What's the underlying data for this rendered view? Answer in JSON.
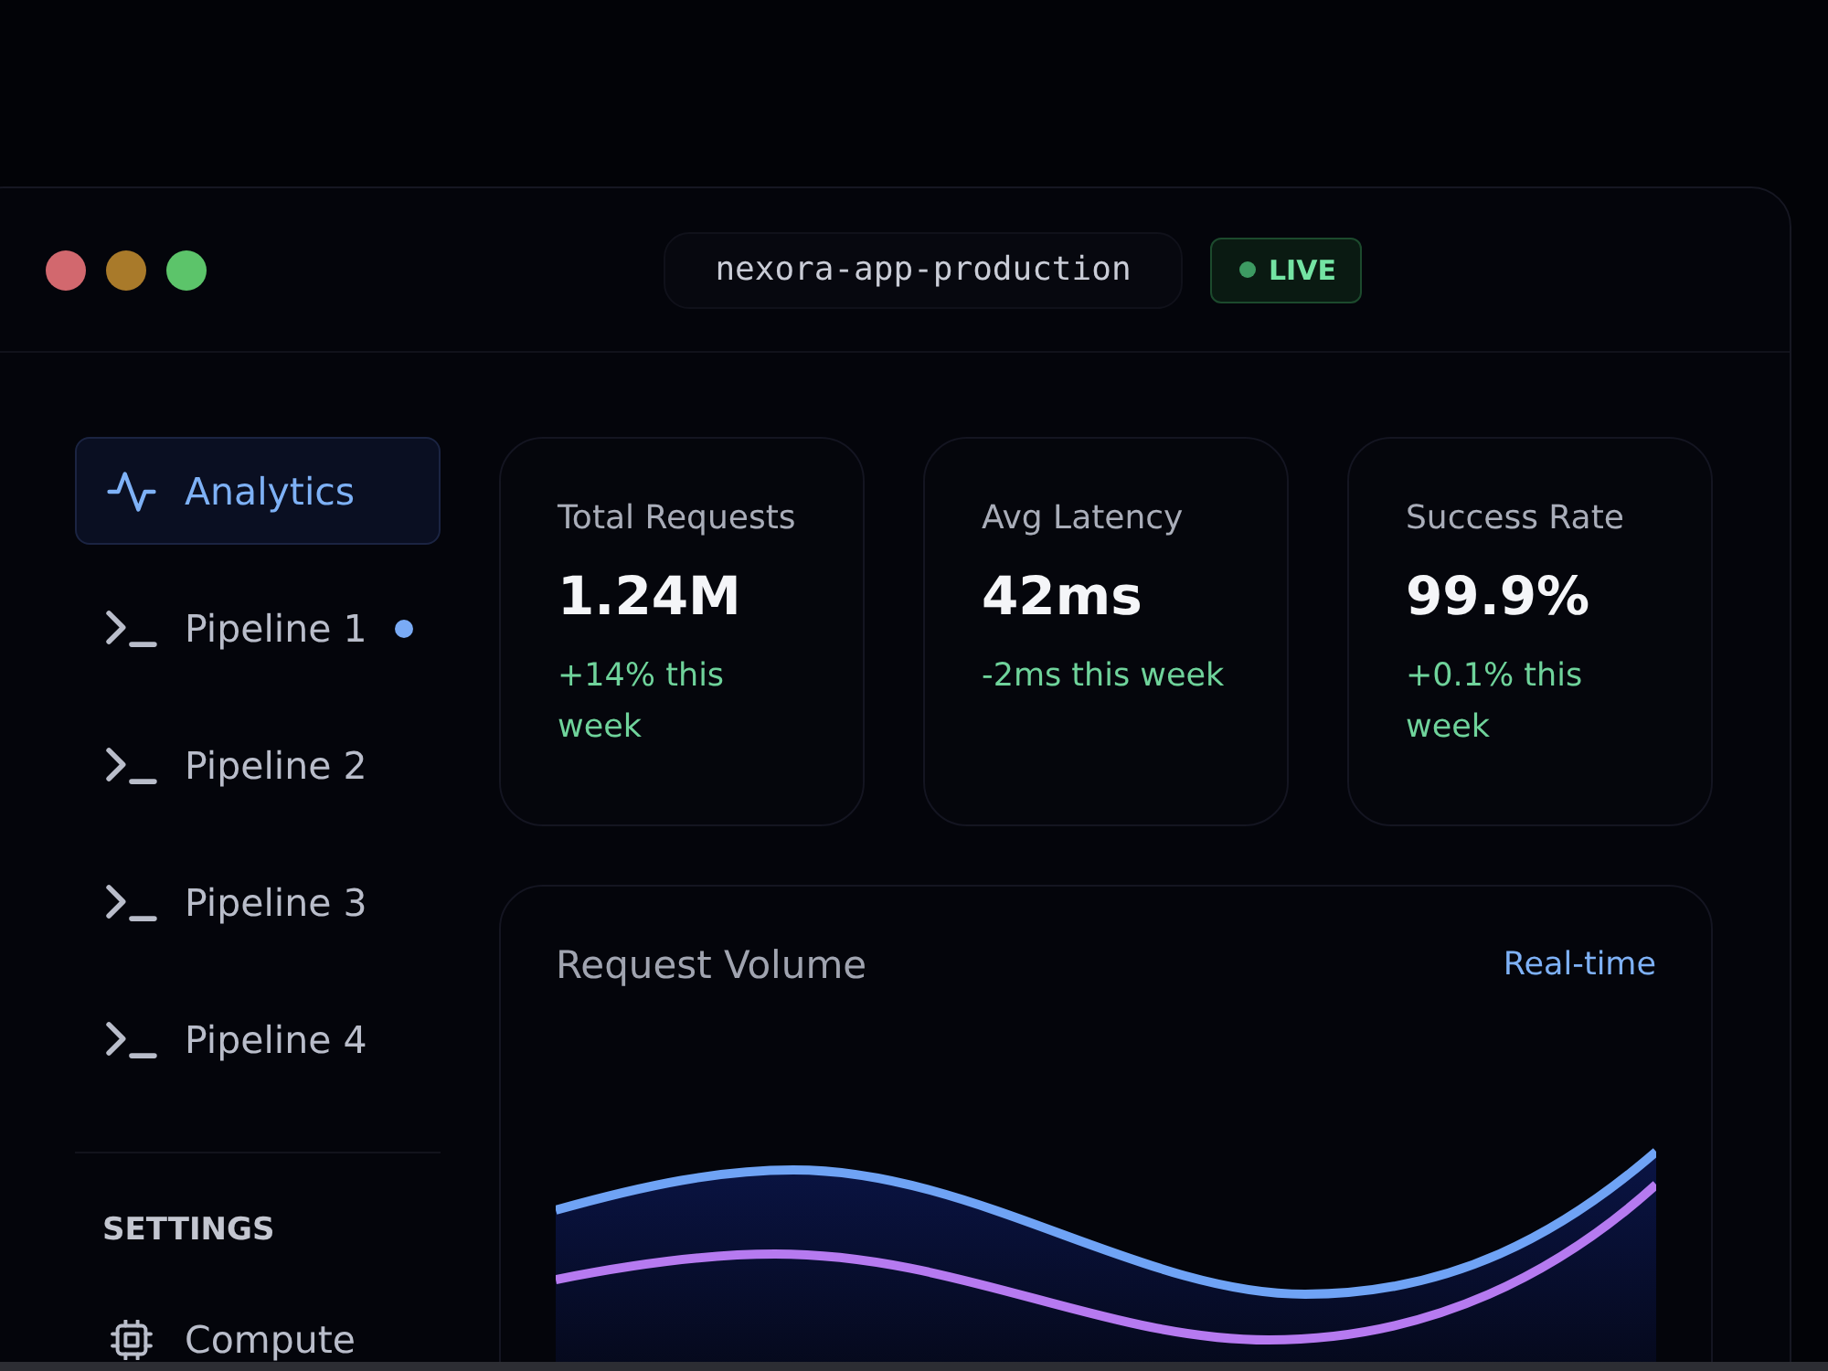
{
  "window": {
    "title": "nexora-app-production",
    "status": {
      "label": "LIVE"
    }
  },
  "sidebar": {
    "items": [
      {
        "label": "Analytics",
        "kind": "activity",
        "selected": true,
        "unread": false
      },
      {
        "label": "Pipeline 1",
        "kind": "terminal",
        "selected": false,
        "unread": true
      },
      {
        "label": "Pipeline 2",
        "kind": "terminal",
        "selected": false,
        "unread": false
      },
      {
        "label": "Pipeline 3",
        "kind": "terminal",
        "selected": false,
        "unread": false
      },
      {
        "label": "Pipeline 4",
        "kind": "terminal",
        "selected": false,
        "unread": false
      }
    ],
    "section": {
      "heading": "SETTINGS",
      "items": [
        {
          "label": "Compute",
          "kind": "chip",
          "selected": false,
          "unread": false
        }
      ]
    }
  },
  "stats": [
    {
      "label": "Total Requests",
      "value": "1.24M",
      "change": "+14% this week"
    },
    {
      "label": "Avg Latency",
      "value": "42ms",
      "change": "-2ms this week"
    },
    {
      "label": "Success Rate",
      "value": "99.9%",
      "change": "+0.1% this week"
    }
  ],
  "chart_panel": {
    "title": "Request Volume",
    "mode": "Real-time"
  }
}
